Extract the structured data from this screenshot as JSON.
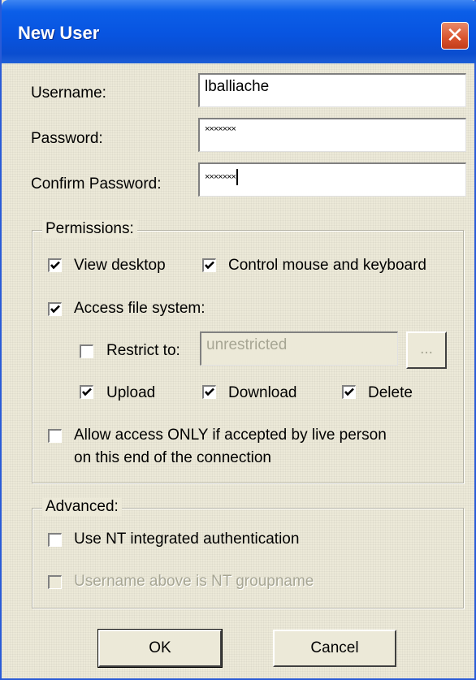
{
  "dialog": {
    "title": "New User",
    "close_symbol": "✕"
  },
  "fields": {
    "username_label": "Username:",
    "username_value": "lballiache",
    "password_label": "Password:",
    "password_value": "×××××××",
    "confirm_label": "Confirm Password:",
    "confirm_value": "×××××××"
  },
  "permissions": {
    "title": "Permissions:",
    "view_desktop": {
      "label": "View desktop",
      "checked": true
    },
    "control_mouse": {
      "label": "Control mouse and keyboard",
      "checked": true
    },
    "access_fs": {
      "label": "Access file system:",
      "checked": true
    },
    "restrict_to": {
      "label": "Restrict to:",
      "checked": false,
      "value": "unrestricted",
      "browse_label": "..."
    },
    "upload": {
      "label": "Upload",
      "checked": true
    },
    "download": {
      "label": "Download",
      "checked": true
    },
    "delete": {
      "label": "Delete",
      "checked": true
    },
    "allow_live_line1": "Allow access ONLY if accepted by live person",
    "allow_live_line2": "on this end of the connection",
    "allow_live_checked": false
  },
  "advanced": {
    "title": "Advanced:",
    "nt_auth": {
      "label": "Use NT integrated authentication",
      "checked": false
    },
    "nt_group": {
      "label": "Username above is NT groupname",
      "checked": false,
      "disabled": true
    }
  },
  "buttons": {
    "ok": "OK",
    "cancel": "Cancel"
  },
  "colors": {
    "titlebar": "#0854e0",
    "dialog_bg": "#ece9d8",
    "close": "#d9532d"
  }
}
